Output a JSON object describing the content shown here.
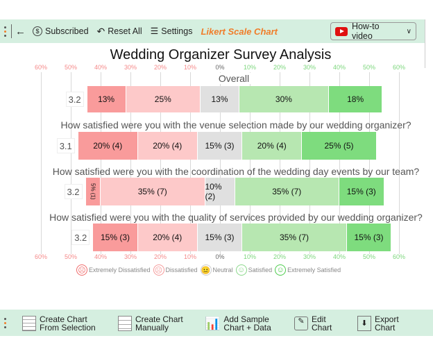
{
  "toolbar": {
    "subscribed": "Subscribed",
    "reset": "Reset All",
    "settings": "Settings",
    "app_title": "Likert Scale Chart",
    "howto": "How-to video"
  },
  "chart_data": {
    "type": "bar",
    "stacked": "diverging",
    "title": "Wedding Organizer Survey Analysis",
    "x_ticks": [
      "60%",
      "50%",
      "40%",
      "30%",
      "20%",
      "10%",
      "0%",
      "10%",
      "20%",
      "30%",
      "40%",
      "50%",
      "60%"
    ],
    "xlim": [
      -60,
      60
    ],
    "grid": true,
    "categories": [
      "Extremely Dissatisfied",
      "Dissatisfied",
      "Neutral",
      "Satisfied",
      "Extremely Satisfied"
    ],
    "colors": [
      "#f99b9b",
      "#fdc9c9",
      "#e0e0e0",
      "#b7e7b1",
      "#7edc7e"
    ],
    "rows": [
      {
        "label": "Overall",
        "score": "3.2",
        "values": [
          13,
          25,
          13,
          30,
          18
        ],
        "labels": [
          "13%",
          "25%",
          "13%",
          "30%",
          "18%"
        ]
      },
      {
        "label": "How satisfied were you with the venue selection made by our wedding organizer?",
        "score": "3.1",
        "values": [
          20,
          20,
          15,
          20,
          25
        ],
        "labels": [
          "20% (4)",
          "20% (4)",
          "15% (3)",
          "20% (4)",
          "25% (5)"
        ]
      },
      {
        "label": "How satisfied were you with the coordination of the wedding day events by our team?",
        "score": "3.2",
        "values": [
          5,
          35,
          10,
          35,
          15
        ],
        "labels": [
          "5% (1)",
          "35% (7)",
          "10% (2)",
          "35% (7)",
          "15% (3)"
        ]
      },
      {
        "label": "How satisfied were you with the quality of services provided by our wedding organizer?",
        "score": "3.2",
        "values": [
          15,
          20,
          15,
          35,
          15
        ],
        "labels": [
          "15% (3)",
          "20% (4)",
          "15% (3)",
          "35% (7)",
          "15% (3)"
        ]
      }
    ],
    "legend": [
      "Extremely Dissatisfied",
      "Dissatisfied",
      "Neutral",
      "Satisfied",
      "Extremely Satisfied"
    ],
    "legend_placement": "bottom"
  },
  "bottom": {
    "b1": [
      "Create Chart",
      "From Selection"
    ],
    "b2": [
      "Create Chart",
      "Manually"
    ],
    "b3": [
      "Add Sample",
      "Chart + Data"
    ],
    "b4": [
      "Edit",
      "Chart"
    ],
    "b5": [
      "Export",
      "Chart"
    ]
  }
}
